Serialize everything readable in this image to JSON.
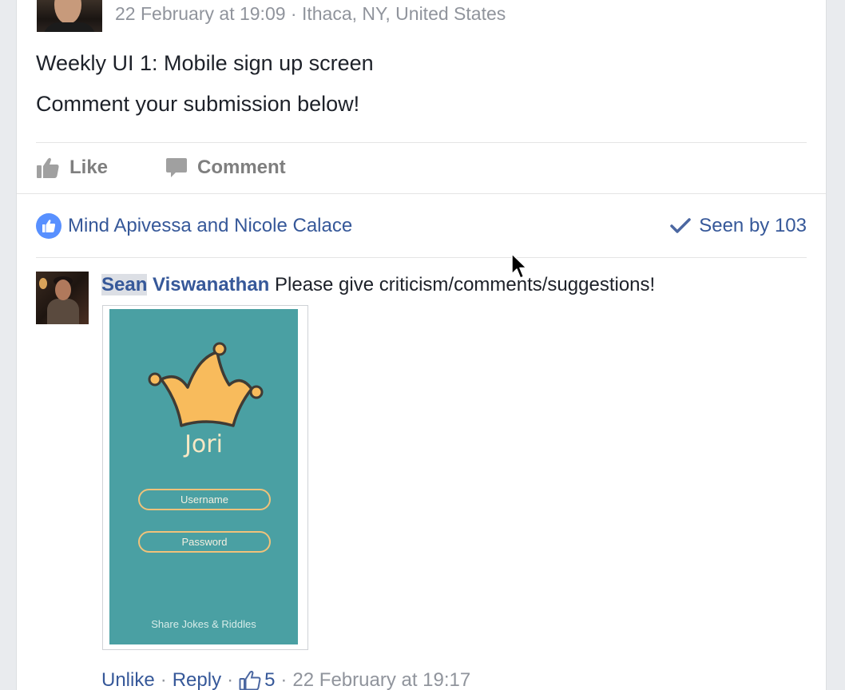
{
  "post": {
    "meta": "22 February at 19:09 · Ithaca, NY, United States",
    "line1": "Weekly UI 1: Mobile sign up screen",
    "line2": "Comment your submission below!"
  },
  "actions": {
    "like": "Like",
    "comment": "Comment"
  },
  "likes": {
    "names": "Mind Apivessa and Nicole Calace",
    "seen": "Seen by 103"
  },
  "comment": {
    "author_first": "Sean",
    "author_last": "Viswanathan",
    "text": "Please give criticism/comments/suggestions!",
    "attachment": {
      "app_name": "Jori",
      "username_placeholder": "Username",
      "password_placeholder": "Password",
      "tagline": "Share Jokes & Riddles"
    },
    "unlike": "Unlike",
    "reply": "Reply",
    "like_count": "5",
    "time": "22 February at 19:17"
  },
  "colors": {
    "link": "#365899",
    "meta_gray": "#90949c",
    "like_blue": "#5890ff",
    "phone_teal": "#4aa0a3",
    "crown_yellow": "#f8bb5c"
  }
}
